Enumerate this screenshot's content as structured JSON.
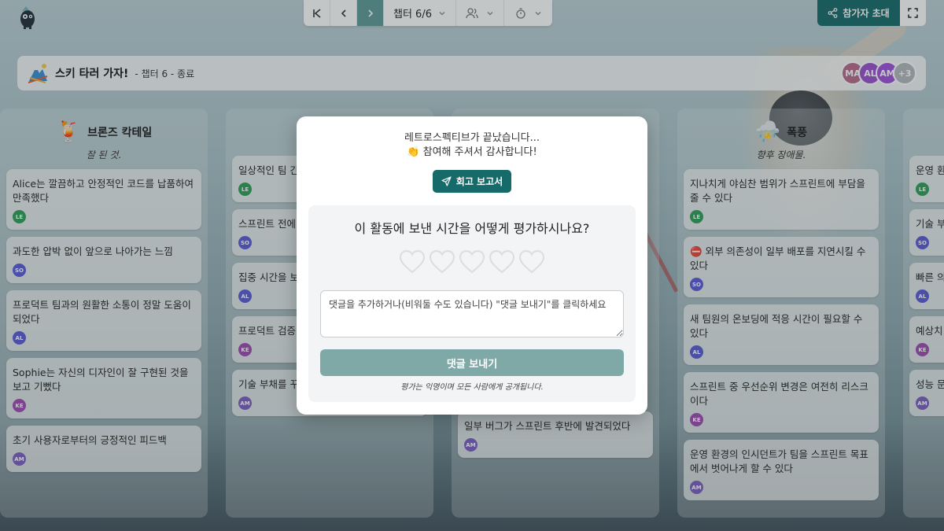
{
  "toolbar": {
    "chapter_label": "챕터 6/6",
    "invite_label": "참가자 초대"
  },
  "header": {
    "title": "스키 타러 가자!",
    "subtitle": "- 챕터 6 - 종료",
    "avatars": [
      {
        "initials": "MA",
        "color": "#b86a8a"
      },
      {
        "initials": "AL",
        "color": "#9a4fd0"
      },
      {
        "initials": "AM",
        "color": "#a050d8"
      },
      {
        "initials": "+3",
        "color": "#b3b8bc"
      }
    ]
  },
  "columns": [
    {
      "title": "브론즈 칵테일",
      "emoji": "🍹",
      "subtitle": "잘 된 것.",
      "cards": [
        {
          "text": "Alice는 깔끔하고 안정적인 코드를 납품하여 만족했다",
          "author": "LE",
          "color": "#2e9e57"
        },
        {
          "text": "과도한 압박 없이 앞으로 나아가는 느낌",
          "author": "SO",
          "color": "#5b5bd6"
        },
        {
          "text": "프로덕트 팀과의 원활한 소통이 정말 도움이 되었다",
          "author": "AL",
          "color": "#5b5bd6"
        },
        {
          "text": "Sophie는 자신의 디자인이 잘 구현된 것을 보고 기뻤다",
          "author": "KE",
          "color": "#a04ab0"
        },
        {
          "text": "초기 사용자로부터의 긍정적인 피드백",
          "author": "AM",
          "color": "#7a5fc0"
        }
      ]
    },
    {
      "title": "",
      "emoji": "🐥",
      "subtitle": "",
      "cards": [
        {
          "text": "일상적인 팀 간",
          "author": "LE",
          "color": "#2e9e57"
        },
        {
          "text": "스프린트 전에 하기",
          "author": "SO",
          "color": "#5b5bd6"
        },
        {
          "text": "집중 시간을 보 기",
          "author": "AL",
          "color": "#5b5bd6"
        },
        {
          "text": "프로덕트 검증",
          "author": "KE",
          "color": "#a04ab0"
        },
        {
          "text": "기술 부채를 꾸준히 줄여 나가기",
          "author": "AM",
          "color": "#7a5fc0"
        }
      ]
    },
    {
      "title": "",
      "emoji": "",
      "subtitle": "",
      "cards": [
        {
          "text": "일부 버그가 스프린트 후반에 발견되었다",
          "author": "AM",
          "color": "#7a5fc0"
        }
      ]
    },
    {
      "title": "폭풍",
      "emoji": "⛈️",
      "subtitle": "향후 장애물.",
      "cards": [
        {
          "text": "지나치게 야심찬 범위가 스프린트에 부담을 줄 수 있다",
          "author": "LE",
          "color": "#2e9e57"
        },
        {
          "text": "⛔ 외부 의존성이 일부 배포를 지연시킬 수 있다",
          "author": "SO",
          "color": "#5b5bd6"
        },
        {
          "text": "새 팀원의 온보딩에 적응 시간이 필요할 수 있다",
          "author": "AL",
          "color": "#5b5bd6"
        },
        {
          "text": "스프린트 중 우선순위 변경은 여전히 리스크이다",
          "author": "KE",
          "color": "#a04ab0"
        },
        {
          "text": "운영 환경의 인시던트가 팀을 스프린트 목표에서 벗어나게 할 수 있다",
          "author": "AM",
          "color": "#7a5fc0"
        }
      ]
    },
    {
      "title": "",
      "emoji": "",
      "subtitle": "",
      "cards": [
        {
          "text": "운영 환",
          "author": "LE",
          "color": "#2e9e57"
        },
        {
          "text": "기술 부",
          "author": "SO",
          "color": "#5b5bd6"
        },
        {
          "text": "빠른 의 하기",
          "author": "AL",
          "color": "#5b5bd6"
        },
        {
          "text": "예상치 유를 두",
          "author": "KE",
          "color": "#a04ab0"
        },
        {
          "text": "성능 문 값 추가",
          "author": "AM",
          "color": "#7a5fc0"
        }
      ]
    }
  ],
  "modal": {
    "line1": "레트로스펙티브가 끝났습니다...",
    "line2": "👏 참여해 주셔서 감사합니다!",
    "report_label": "회고 보고서",
    "rating_question": "이 활동에 보낸 시간을 어떻게 평가하시나요?",
    "rating_max": 5,
    "rating_value": 0,
    "comment_placeholder": "댓글을 추가하거나(비워둘 수도 있습니다) \"댓글 보내기\"를 클릭하세요",
    "send_label": "댓글 보내기",
    "anon_note": "평가는 익명이며 모든 사람에게 공개됩니다."
  }
}
